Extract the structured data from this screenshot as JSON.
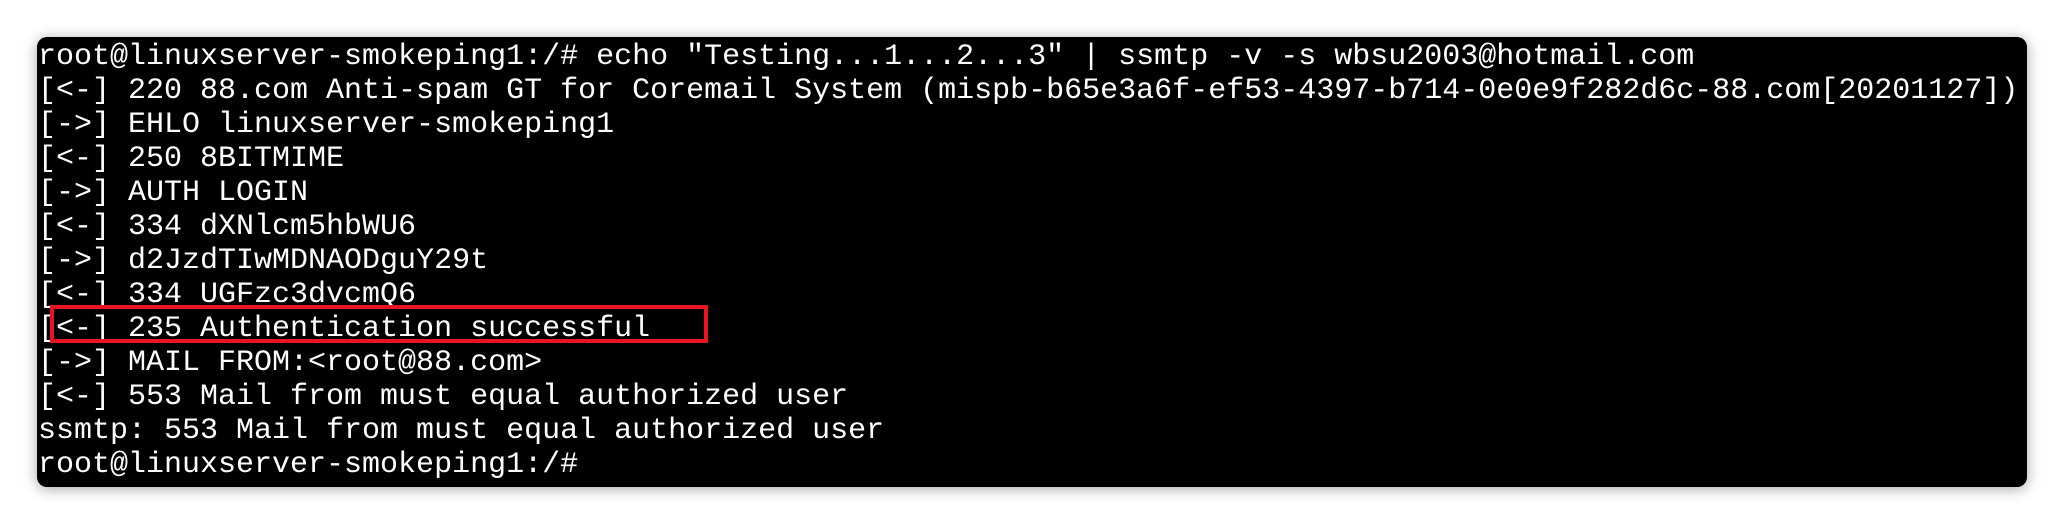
{
  "terminal": {
    "lines": [
      "root@linuxserver-smokeping1:/# echo \"Testing...1...2...3\" | ssmtp -v -s wbsu2003@hotmail.com",
      "[<-] 220 88.com Anti-spam GT for Coremail System (mispb-b65e3a6f-ef53-4397-b714-0e0e9f282d6c-88.com[20201127])",
      "[->] EHLO linuxserver-smokeping1",
      "[<-] 250 8BITMIME",
      "[->] AUTH LOGIN",
      "[<-] 334 dXNlcm5hbWU6",
      "[->] d2JzdTIwMDNAODguY29t",
      "[<-] 334 UGFzc3dvcmQ6",
      "[<-] 235 Authentication successful",
      "[->] MAIL FROM:<root@88.com>",
      "[<-] 553 Mail from must equal authorized user",
      "ssmtp: 553 Mail from must equal authorized user",
      "root@linuxserver-smokeping1:/#"
    ],
    "highlight_color": "#e8141e",
    "background_color": "#000000",
    "text_color": "#ffffff"
  }
}
